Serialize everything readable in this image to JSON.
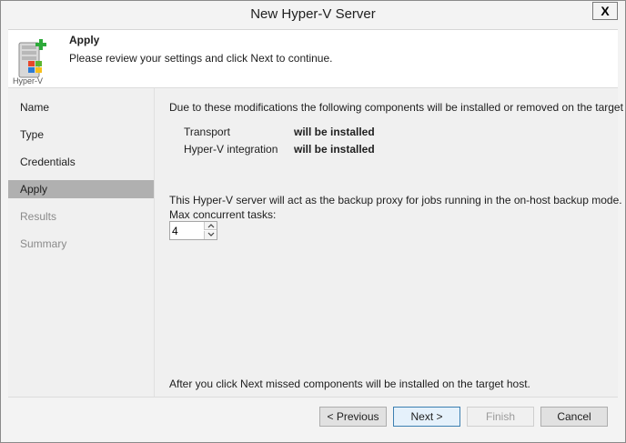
{
  "window": {
    "title": "New Hyper-V Server",
    "close_label": "X"
  },
  "header": {
    "step_title": "Apply",
    "subtitle": "Please review your settings and click Next to continue.",
    "icon_caption": "Hyper-V"
  },
  "nav": {
    "items": [
      {
        "label": "Name",
        "state": "normal"
      },
      {
        "label": "Type",
        "state": "normal"
      },
      {
        "label": "Credentials",
        "state": "normal"
      },
      {
        "label": "Apply",
        "state": "active"
      },
      {
        "label": "Results",
        "state": "disabled"
      },
      {
        "label": "Summary",
        "state": "disabled"
      }
    ]
  },
  "content": {
    "intro": "Due to these modifications the following components will be installed or removed on the target host:",
    "components": [
      {
        "name": "Transport",
        "status": "will be installed"
      },
      {
        "name": "Hyper-V integration",
        "status": "will be installed"
      }
    ],
    "proxy_note": "This Hyper-V server will act as the backup proxy for jobs running in the on-host backup mode.",
    "max_tasks_label": "Max concurrent tasks:",
    "max_tasks_value": "4",
    "footer_note": "After you click Next missed components will be installed on the target host."
  },
  "buttons": {
    "previous": "< Previous",
    "next": "Next >",
    "finish": "Finish",
    "cancel": "Cancel"
  },
  "colors": {
    "active_nav": "#b0b0b0",
    "default_button_border": "#3c7fb1",
    "plus_green": "#2eaa3a"
  }
}
